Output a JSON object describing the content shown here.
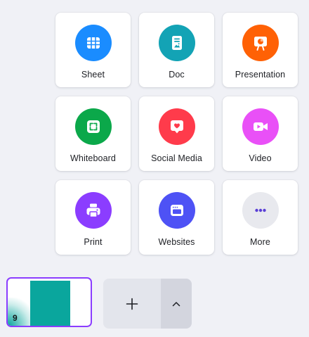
{
  "create_menu": {
    "items": [
      {
        "label": "Sheet",
        "icon": "sheet-icon",
        "color": "#1a8cff"
      },
      {
        "label": "Doc",
        "icon": "doc-icon",
        "color": "#13a3b5"
      },
      {
        "label": "Presentation",
        "icon": "presentation-icon",
        "color": "#ff6105"
      },
      {
        "label": "Whiteboard",
        "icon": "whiteboard-icon",
        "color": "#0ba84a"
      },
      {
        "label": "Social Media",
        "icon": "social-media-icon",
        "color": "#ff3b4b"
      },
      {
        "label": "Video",
        "icon": "video-icon",
        "color": "#e950f7"
      },
      {
        "label": "Print",
        "icon": "print-icon",
        "color": "#8b3dff"
      },
      {
        "label": "Websites",
        "icon": "websites-icon",
        "color": "#4e52f5"
      },
      {
        "label": "More",
        "icon": "more-dots-icon",
        "color": "#e8e9ee"
      }
    ]
  },
  "pages": {
    "current_page_number": "9",
    "thumbnail_accent": "#0aa69d",
    "selected_border": "#8b3dff",
    "add_page_icon": "plus-icon",
    "expand_icon": "chevron-up-icon"
  }
}
